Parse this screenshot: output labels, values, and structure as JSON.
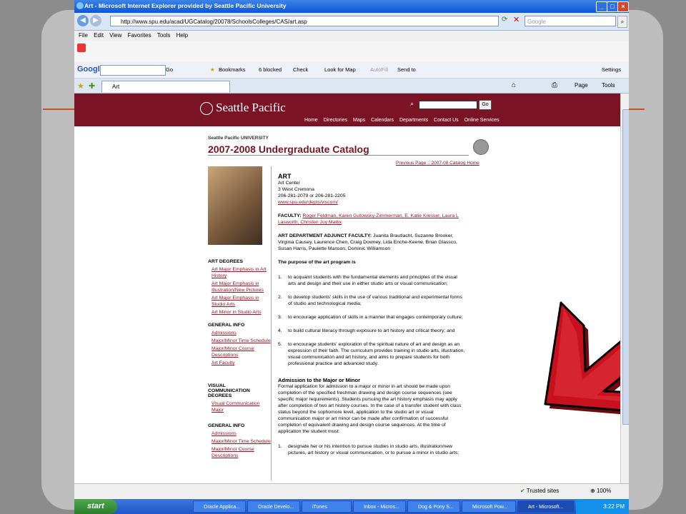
{
  "window": {
    "title": "Art - Microsoft Internet Explorer provided by Seattle Pacific University",
    "min": "_",
    "max": "□",
    "close": "×"
  },
  "address": {
    "url": "http://www.spu.edu/acad/UGCatalog/20078/SchoolsColleges/CAS/art.asp",
    "search_placeholder": "Google"
  },
  "menu": [
    "File",
    "Edit",
    "View",
    "Favorites",
    "Tools",
    "Help"
  ],
  "google_toolbar": {
    "logo": "Google",
    "go": "Go",
    "bookmarks": "Bookmarks",
    "blocked": "6 blocked",
    "check": "Check",
    "look_for_map": "Look for Map",
    "autofill": "AutoFill",
    "send_to": "Send to",
    "settings": "Settings"
  },
  "tab": {
    "label": "Art",
    "page": "Page",
    "tools": "Tools"
  },
  "site": {
    "logo": "Seattle Pacific",
    "go": "Go",
    "nav": [
      "Home",
      "Directories",
      "Maps",
      "Calendars",
      "Departments",
      "Contact Us",
      "Online Services"
    ],
    "university_label": "Seattle Pacific UNIVERSITY",
    "catalog_title": "2007-2008 Undergraduate Catalog",
    "crumb_prev": "Previous Page",
    "crumb_sep": " :: ",
    "crumb_home": "2007-08 Catalog Home"
  },
  "sidebar": {
    "art_degrees_heading": "ART DEGREES",
    "art_degrees": [
      "Art Major Emphasis in Art History",
      "Art Major Emphasis in Illustration/New Pictures",
      "Art Major Emphasis in Studio Arts",
      "Art Minor in Studio Arts"
    ],
    "general_info_heading": "GENERAL INFO",
    "general_info": [
      "Admissions",
      "Major/Minor Time Schedule",
      "Major/Minor Course Descriptions",
      "Art Faculty"
    ],
    "visual_heading": "VISUAL COMMUNICATION DEGREES",
    "visual": [
      "Visual Communication Major"
    ],
    "general_info2_heading": "GENERAL INFO",
    "general_info2": [
      "Admissions",
      "Major/Minor Time Schedule",
      "Major/Minor Course Descriptions"
    ]
  },
  "main": {
    "heading": "ART",
    "address_lines": [
      "Art Center",
      "3 West Cremona",
      "206-281-2079 or 206-281-2205"
    ],
    "url": "www.spu.edu/depts/viscom/",
    "faculty_label": "FACULTY:",
    "faculty": "Roger Feldman, Karen Gutowsky-Zimmerman, E. Katie Kresser, Laura L Lasworth, Christen Joy Mattix",
    "adjunct_label": "ART DEPARTMENT ADJUNCT FACULTY:",
    "adjunct": "Juanita Brautlacht, Suzanne Brooker, Virginia Causey, Laurence Chen, Craig Downey, Lida Enche-Keene, Brian Glassco, Susan Harris, Paulette Manson, Dominic Williamson",
    "purpose_heading": "The purpose of the art program is",
    "purpose": [
      {
        "n": "1.",
        "t": "to acquaint students with the fundamental elements and principles of the visual arts and design and their use in either studio arts or visual communication;"
      },
      {
        "n": "2.",
        "t": "to develop students' skills in the use of various traditional and experimental forms of studio and technological media;"
      },
      {
        "n": "3.",
        "t": "to encourage application of skills in a manner that engages contemporary culture;"
      },
      {
        "n": "4.",
        "t": "to build cultural literacy through exposure to art history and critical theory; and"
      },
      {
        "n": "5.",
        "t": "to encourage students' exploration of the spiritual nature of art and design as an expression of their faith. The curriculum provides training in studio arts, illustration, visual communication and art history, and aims to prepare students for both professional practice and advanced study."
      }
    ],
    "admission_heading": "Admission to the Major or Minor",
    "admission_text": "Formal application for admission to a major or minor in art should be made upon completion of the specified freshman drawing and design course sequences (see specific major requirements). Students pursuing the art history emphasis may apply after completion of two art history courses. In the case of a transfer student with class status beyond the sophomore level, application to the studio art or visual communication major or art minor can be made after confirmation of successful completion of equivalent drawing and design course sequences. At the time of application the student must:",
    "admission_list": [
      {
        "n": "1.",
        "t": "designate her or his intention to pursue studies in studio arts, illustration/new pictures, art history or visual communication, or to pursue a minor in studio arts;"
      }
    ]
  },
  "status": {
    "trusted": "Trusted sites",
    "zoom": "100%"
  },
  "taskbar": {
    "start": "start",
    "items": [
      "Oracle Applica...",
      "Oracle Develo...",
      "iTunes",
      "Inbox - Micros...",
      "Dog & Pony S...",
      "Microsoft Pow...",
      "Art - Microsoft..."
    ],
    "clock": "3:22 PM"
  },
  "colors": {
    "spu_maroon": "#7a1424",
    "link_red": "#a01020",
    "arrow_red": "#c8101e"
  }
}
